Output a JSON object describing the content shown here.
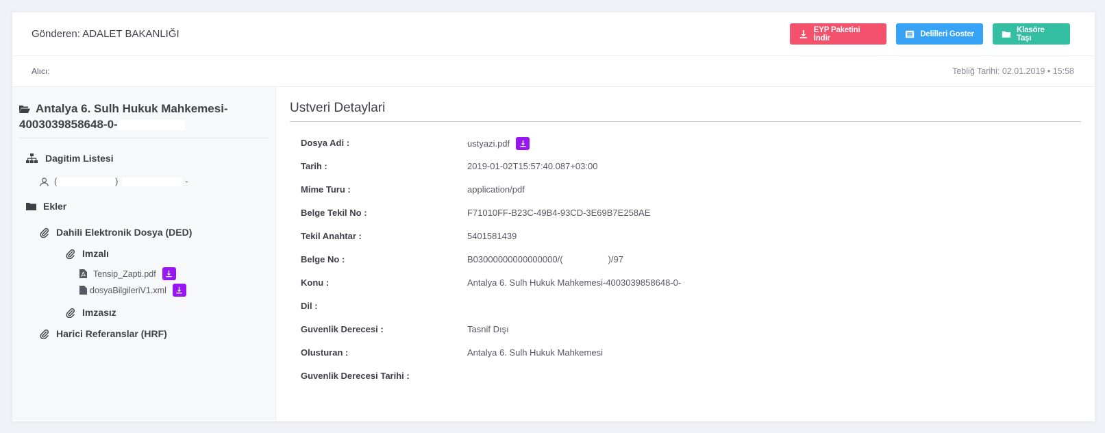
{
  "header": {
    "sender_label": "Gönderen: ADALET BAKANLIĞI",
    "buttons": {
      "download_package": "EYP Paketini İndir",
      "show_evidence": "Delilleri Goster",
      "move_to_folder": "Klasöre Taşı"
    }
  },
  "subheader": {
    "recipient_label": "Alıcı:",
    "notification_date": "Tebliğ Tarihi: 02.01.2019 • 15:58"
  },
  "left": {
    "title_line1": "Antalya 6. Sulh Hukuk Mahkemesi-",
    "title_line2": "4003039858648-0-",
    "distribution": {
      "label": "Dagitim Listesi",
      "recipient_prefix": "(",
      "recipient_mid": ")",
      "recipient_suffix": "-"
    },
    "attachments": {
      "label": "Ekler",
      "ded": "Dahili Elektronik Dosya (DED)",
      "signed": "Imzalı",
      "file1": "Tensip_Zapti.pdf",
      "file2": "dosyaBilgileriV1.xml",
      "unsigned": "Imzasız",
      "hrf": "Harici Referanslar (HRF)"
    }
  },
  "metadata": {
    "title": "Ustveri Detaylari",
    "rows": [
      {
        "key": "Dosya Adi :",
        "value": "ustyazi.pdf"
      },
      {
        "key": "Tarih :",
        "value": "2019-01-02T15:57:40.087+03:00"
      },
      {
        "key": "Mime Turu :",
        "value": "application/pdf"
      },
      {
        "key": "Belge Tekil No :",
        "value": "F71010FF-B23C-49B4-93CD-3E69B7E258AE"
      },
      {
        "key": "Tekil Anahtar :",
        "value": "5401581439"
      },
      {
        "key": "Belge No :",
        "value": "B03000000000000000/(",
        "value_suffix": ")/97"
      },
      {
        "key": "Konu :",
        "value": "Antalya 6. Sulh Hukuk Mahkemesi-4003039858648-0-"
      },
      {
        "key": "Dil :",
        "value": ""
      },
      {
        "key": "Guvenlik Derecesi :",
        "value": "Tasnif Dışı"
      },
      {
        "key": "Olusturan :",
        "value": "Antalya 6. Sulh Hukuk Mahkemesi"
      },
      {
        "key": "Guvenlik Derecesi Tarihi :",
        "value": ""
      }
    ]
  },
  "colors": {
    "red": "#f4516c",
    "blue": "#36a3f7",
    "green": "#34bfa3",
    "purple": "#9816f4"
  }
}
